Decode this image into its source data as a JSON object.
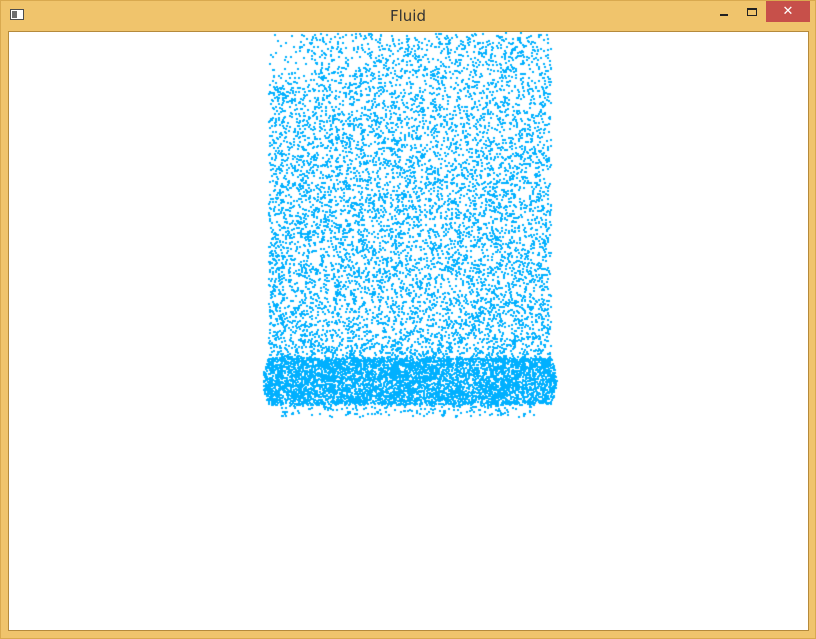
{
  "window": {
    "title": "Fluid",
    "close_glyph": "✕",
    "icons": {
      "app": "application-icon",
      "minimize": "minimize-icon",
      "maximize": "maximize-icon",
      "close": "close-icon"
    }
  },
  "colors": {
    "frame": "#f0c46c",
    "close_button": "#c7504a",
    "particle": "#00b0ff",
    "background": "#ffffff"
  }
}
